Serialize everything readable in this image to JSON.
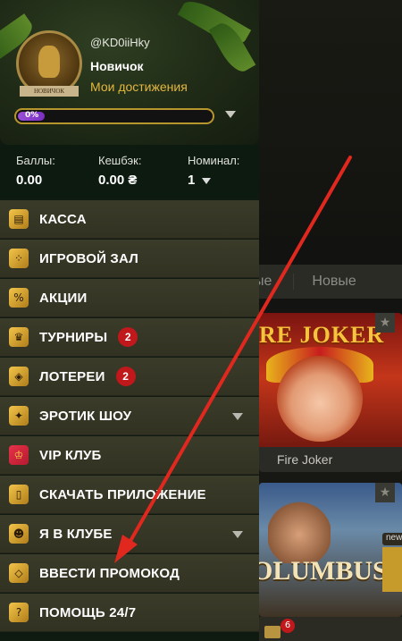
{
  "background": {
    "tabs": [
      "ые",
      "Новые"
    ],
    "games": [
      {
        "title_art": "RE JOKER",
        "caption": "Fire Joker"
      },
      {
        "title_art": "OLUMBUS",
        "caption": ""
      }
    ],
    "new_badge": "new",
    "nav_badge": "6"
  },
  "profile": {
    "username": "@KD0iiHky",
    "rank": "Новичок",
    "achievements_link": "Мои достижения",
    "rank_plate": "НОВИЧОК",
    "progress_label": "0%",
    "progress_value": 0
  },
  "stats": {
    "points_label": "Баллы:",
    "points_value": "0.00",
    "cashback_label": "Кешбэк:",
    "cashback_value": "0.00 ₴",
    "nominal_label": "Номинал:",
    "nominal_value": "1"
  },
  "menu": [
    {
      "label": "КАССА",
      "icon": "cashier-icon"
    },
    {
      "label": "ИГРОВОЙ ЗАЛ",
      "icon": "slots-icon"
    },
    {
      "label": "АКЦИИ",
      "icon": "percent-icon"
    },
    {
      "label": "ТУРНИРЫ",
      "icon": "trophy-icon",
      "badge": "2"
    },
    {
      "label": "ЛОТЕРЕИ",
      "icon": "ticket-icon",
      "badge": "2"
    },
    {
      "label": "ЭРОТИК ШОУ",
      "icon": "show-icon",
      "expandable": true
    },
    {
      "label": "VIP КЛУБ",
      "icon": "crown-icon"
    },
    {
      "label": "СКАЧАТЬ ПРИЛОЖЕНИЕ",
      "icon": "phone-icon"
    },
    {
      "label": "Я В КЛУБЕ",
      "icon": "monkey-icon",
      "expandable": true
    },
    {
      "label": "ВВЕСТИ ПРОМОКОД",
      "icon": "promo-ticket-icon"
    },
    {
      "label": "ПОМОЩЬ 24/7",
      "icon": "help-icon"
    }
  ],
  "colors": {
    "accent_gold": "#e3b73f",
    "arrow_red": "#e0281f",
    "badge_red": "#c0181b",
    "menu_bg": "#3b3b2a"
  }
}
